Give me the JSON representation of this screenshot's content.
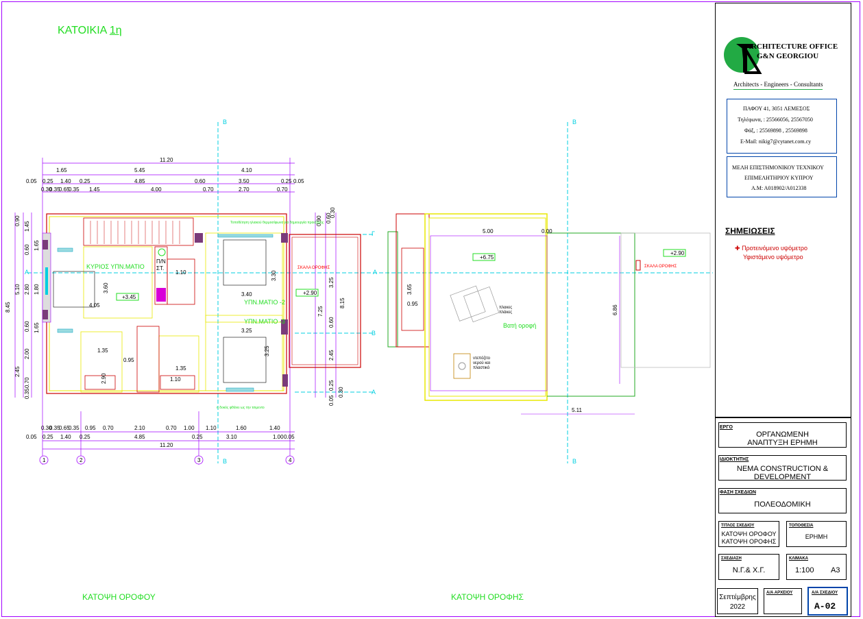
{
  "sheet": {
    "main_title": "ΚΑΤΟΙΚΙΑ",
    "main_title_suffix": "1η",
    "caption_floor": "ΚΑΤΟΨΗ ΟΡΟΦΟΥ",
    "caption_roof": "ΚΑΤΟΨΗ ΟΡΟΦΗΣ"
  },
  "floor_plan": {
    "top_dims_row1": [
      "11.20"
    ],
    "top_dims_row2": [
      "1.65",
      "5.45",
      "4.10"
    ],
    "top_dims_row3": [
      "0.05",
      "0.25",
      "1.40",
      "0.25",
      "4.85",
      "0.60",
      "3.50",
      "0.25",
      "0.05"
    ],
    "top_dims_row4": [
      "0.30",
      "0.35",
      "0.65",
      "0.35",
      "1.45",
      "4.00",
      "0.70",
      "2.70",
      "0.70"
    ],
    "bottom_dims_row1": [
      "0.30",
      "0.35",
      "0.65",
      "0.35",
      "0.95",
      "0.70",
      "2.10",
      "0.70",
      "1.00",
      "1.10",
      "1.60",
      "1.40"
    ],
    "bottom_dims_row2": [
      "0.05",
      "0.25",
      "1.40",
      "0.25",
      "4.85",
      "0.25",
      "3.10",
      "1.00",
      "0.05"
    ],
    "bottom_dims_row3": [
      "11.20"
    ],
    "left_dims": [
      "0.90",
      "1.45",
      "1.65",
      "0.60",
      "2.80",
      "1.80",
      "5.10",
      "8.45",
      "0.60",
      "1.65",
      "2.00",
      "2.45",
      "0.70",
      "0.35"
    ],
    "right_dims": [
      "0.90",
      "0.60",
      "0.30",
      "8.15",
      "3.25",
      "7.25",
      "0.60",
      "2.45",
      "0.25",
      "0.05",
      "0.30"
    ],
    "rooms": {
      "master": "ΚΥΡΙΟΣ ΥΠΝ.ΜΑΤΙΟ",
      "bed2": "ΥΠΝ.ΜΑΤΙΟ -2",
      "bed3": "ΥΠΝ.ΜΑΤΙΟ -3",
      "wc_label": "Π/Ν",
      "wc_label2": "ΣΤ.",
      "stair": "ΣΚΑΛΑ ΟΡΟΦΗΣ"
    },
    "levels": {
      "a": "+3.45",
      "b": "+2.90"
    },
    "inner_dims": [
      "3.60",
      "4.05",
      "1.10",
      "3.40",
      "3.30",
      "3.25",
      "3.25",
      "1.35",
      "0.95",
      "2.90",
      "1.35",
      "1.10"
    ],
    "notes": {
      "solar": "Τοποθέτηση ηλιακού θερμοσίφωνα για δημιουργία προεξοχής",
      "beam": "η δοκός φθάνει ως την τσιμεντο"
    },
    "axes_num": [
      "1",
      "2",
      "3",
      "4"
    ],
    "axes_let": [
      "A",
      "B",
      "Γ"
    ]
  },
  "roof_plan": {
    "dims": [
      "5.00",
      "0.00",
      "3.65",
      "0.95",
      "6.86",
      "5.11"
    ],
    "levels": {
      "a": "+6.75",
      "b": "+2.90"
    },
    "labels": {
      "tiles": "πλακες",
      "tiles2": "πλάκες",
      "deep_roof": "Βατή οροφή",
      "tank": "ντεπόζιτο",
      "tank2": "νερού και",
      "tank3": "πλαστικό",
      "stair": "ΣΚΑΛΑ ΟΡΟΦΗΣ"
    },
    "legend": {
      "proposed": "Προτεινόμενο υψόμετρο",
      "existing": "Υφιστάμενο υψόμετρο"
    },
    "notes_title": "ΣΗΜΕΙΩΣΕΙΣ"
  },
  "title_block": {
    "office1": "ARCHITECTURE OFFICE",
    "office2": "G&N GEORGIOU",
    "tagline": "Architects - Engineers - Consultants",
    "addr": "ΠΑΦΟΥ 41, 3051 ΛΕΜΕΣΟΣ",
    "tel": "Τηλέφωνα, : 25566056, 25567050",
    "fax": "Φάξ, : 25569898 , 25569898",
    "email": "E-Mail: nikig7@cytanet.com.cy",
    "member1": "ΜΕΛΗ ΕΠΙΣΤΗΜΟΝΙΚΟΥ ΤΕΧΝΙΚΟΥ",
    "member2": "ΕΠΙΜΕΛΗΤΗΡΙΟΥ ΚΥΠΡΟΥ",
    "member3": "Α.Μ: Α018902/Α012338",
    "project_label": "ΕΡΓΟ",
    "project1": "ΟΡΓΑΝΩΜΕΝΗ",
    "project2": "ΑΝΑΠΤΥΞΗ ΕΡΗΜΗ",
    "owner_label": "ΙΔΙΟΚΤΗΤΗΣ",
    "owner1": "NEMA CONSTRUCTION &",
    "owner2": "DEVELOPMENT",
    "phase_label": "ΦΑΣΗ ΣΧΕΔΙΩΝ",
    "phase": "ΠΟΛΕΟΔΟΜΙΚΗ",
    "dtitle_label": "ΤΙΤΛΟΣ ΣΧΕΔΙΟΥ",
    "dtitle1": "ΚΑΤΟΨΗ ΟΡΟΦΟΥ",
    "dtitle2": "ΚΑΤΟΨΗ ΟΡΟΦΗΣ",
    "loc_label": "ΤΟΠΟΘΕΣΙΑ",
    "loc": "ΕΡΗΜΗ",
    "drawn_label": "ΣΧΕΔΙΑΣΗ",
    "drawn": "Ν.Γ.& Χ.Γ.",
    "scale_label": "ΚΛΙΜΑΚΑ",
    "scale": "1:100",
    "paper": "Α3",
    "date1": "Σεπτέμβρης",
    "date2": "2022",
    "archive_label": "Α/Α ΑΡΧΕΙΟΥ",
    "sheet_label": "Α/Α ΣΧΕΔΙΟΥ",
    "sheet_no": "Α-02"
  },
  "colors": {
    "frame": "#a200ff",
    "green": "#22dd22",
    "cyan": "#00cfe0",
    "yellow": "#e8e800",
    "red": "#cc0000"
  }
}
